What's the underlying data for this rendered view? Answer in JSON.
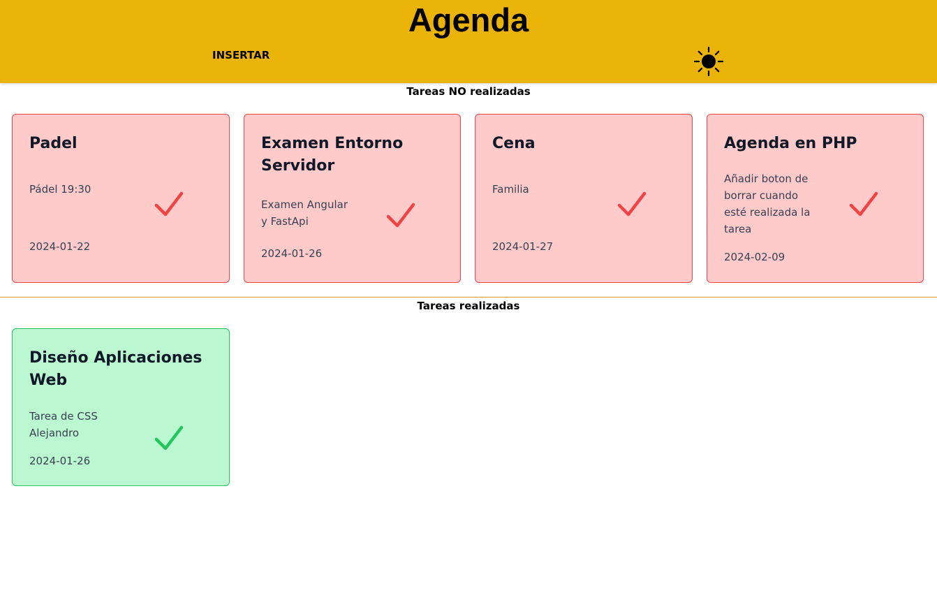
{
  "header": {
    "title": "Agenda",
    "insert_label": "INSERTAR",
    "theme_icon": "sun-icon",
    "background": "#eab308"
  },
  "pending": {
    "title": "Tareas NO realizadas",
    "color": "#ef4444",
    "tasks": [
      {
        "title": "Padel",
        "description": "Pádel 19:30",
        "date": "2024-01-22"
      },
      {
        "title": "Examen Entorno Servidor",
        "description": "Examen Angular y FastApi",
        "date": "2024-01-26"
      },
      {
        "title": "Cena",
        "description": "Familia",
        "date": "2024-01-27"
      },
      {
        "title": "Agenda en PHP",
        "description": "Añadir boton de borrar cuando esté realizada la tarea",
        "date": "2024-02-09"
      }
    ]
  },
  "done": {
    "title": "Tareas realizadas",
    "color": "#22c55e",
    "tasks": [
      {
        "title": "Diseño Aplicaciones Web",
        "description": "Tarea de CSS Alejandro",
        "date": "2024-01-26"
      }
    ]
  }
}
